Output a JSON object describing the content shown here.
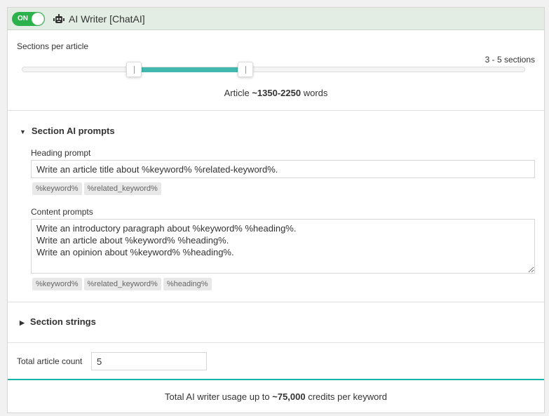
{
  "header": {
    "toggle_label": "ON",
    "toggle_on": true,
    "title": "AI Writer [ChatAI]",
    "icon": "robot-icon"
  },
  "slider": {
    "label": "Sections per article",
    "range_text": "3 - 5 sections",
    "min": 1,
    "max": 10,
    "low": 3,
    "high": 5,
    "accent": "#42b8ae"
  },
  "words": {
    "prefix": "Article ",
    "value": "~1350-2250",
    "suffix": " words"
  },
  "prompts": {
    "title": "Section AI prompts",
    "expanded": true,
    "heading_label": "Heading prompt",
    "heading_value": "Write an article title about %keyword% %related-keyword%.",
    "heading_tags": [
      "%keyword%",
      "%related_keyword%"
    ],
    "content_label": "Content prompts",
    "content_value": "Write an introductory paragraph about %keyword% %heading%.\nWrite an article about %keyword% %heading%.\nWrite an opinion about %keyword% %heading%.",
    "content_tags": [
      "%keyword%",
      "%related_keyword%",
      "%heading%"
    ]
  },
  "strings": {
    "title": "Section strings",
    "expanded": false
  },
  "count": {
    "label": "Total article count",
    "value": "5"
  },
  "footer": {
    "prefix": "Total AI writer usage up to ",
    "value": "~75,000",
    "suffix": " credits per keyword"
  }
}
